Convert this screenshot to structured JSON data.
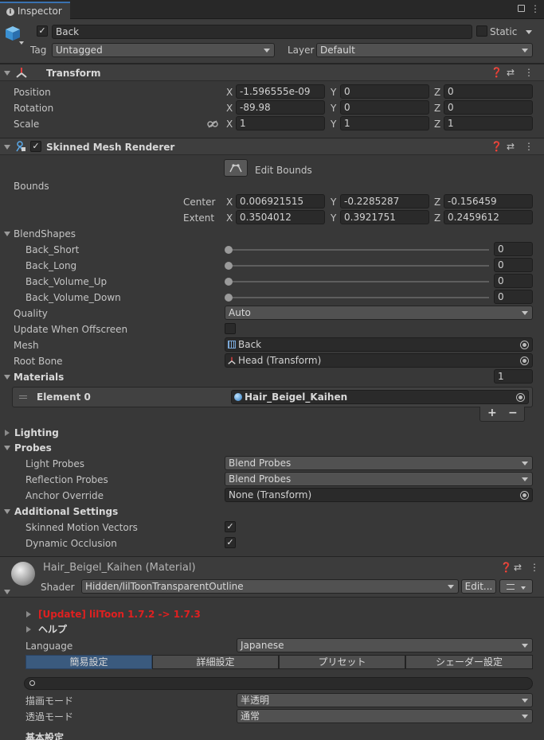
{
  "window": {
    "tab_title": "Inspector"
  },
  "object": {
    "name": "Back",
    "static_label": "Static",
    "tag_label": "Tag",
    "tag_value": "Untagged",
    "layer_label": "Layer",
    "layer_value": "Default"
  },
  "transform": {
    "title": "Transform",
    "position_label": "Position",
    "rotation_label": "Rotation",
    "scale_label": "Scale",
    "axis_x": "X",
    "axis_y": "Y",
    "axis_z": "Z",
    "position": {
      "x": "-1.596555e-09",
      "y": "0",
      "z": "0"
    },
    "rotation": {
      "x": "-89.98",
      "y": "0",
      "z": "0"
    },
    "scale": {
      "x": "1",
      "y": "1",
      "z": "1"
    }
  },
  "skinned": {
    "title": "Skinned Mesh Renderer",
    "edit_bounds_label": "Edit Bounds",
    "bounds_label": "Bounds",
    "center_label": "Center",
    "extent_label": "Extent",
    "center": {
      "x": "0.006921515",
      "y": "-0.2285287",
      "z": "-0.156459"
    },
    "extent": {
      "x": "0.3504012",
      "y": "0.3921751",
      "z": "0.2459612"
    },
    "blendshapes_label": "BlendShapes",
    "blendshapes": [
      {
        "name": "Back_Short",
        "value": "0"
      },
      {
        "name": "Back_Long",
        "value": "0"
      },
      {
        "name": "Back_Volume_Up",
        "value": "0"
      },
      {
        "name": "Back_Volume_Down",
        "value": "0"
      }
    ],
    "quality_label": "Quality",
    "quality_value": "Auto",
    "update_offscreen_label": "Update When Offscreen",
    "mesh_label": "Mesh",
    "mesh_value": "Back",
    "root_bone_label": "Root Bone",
    "root_bone_value": "Head (Transform)",
    "materials_label": "Materials",
    "materials_count": "1",
    "element0_label": "Element 0",
    "element0_value": "Hair_Beigel_Kaihen",
    "plus": "+",
    "minus": "−",
    "lighting_label": "Lighting",
    "probes_label": "Probes",
    "light_probes_label": "Light Probes",
    "light_probes_value": "Blend Probes",
    "reflection_probes_label": "Reflection Probes",
    "reflection_probes_value": "Blend Probes",
    "anchor_override_label": "Anchor Override",
    "anchor_override_value": "None (Transform)",
    "additional_label": "Additional Settings",
    "motion_vectors_label": "Skinned Motion Vectors",
    "dynamic_occlusion_label": "Dynamic Occlusion",
    "check_mark": "✓"
  },
  "material": {
    "title": "Hair_Beigel_Kaihen (Material)",
    "shader_label": "Shader",
    "shader_value": "Hidden/lilToonTransparentOutline",
    "edit_label": "Edit...",
    "update_notice": "[Update] lilToon 1.7.2 -> 1.7.3",
    "help_label": "ヘルプ",
    "language_label": "Language",
    "language_value": "Japanese",
    "tabs": [
      "簡易設定",
      "詳細設定",
      "プリセット",
      "シェーダー設定"
    ],
    "render_mode_label": "描画モード",
    "render_mode_value": "半透明",
    "transparent_mode_label": "透過モード",
    "transparent_mode_value": "通常",
    "basic_settings_label": "基本設定"
  },
  "colors": {
    "accent": "#3a72b0",
    "warning": "#e02020",
    "selected_tab": "#3a5a7e"
  }
}
